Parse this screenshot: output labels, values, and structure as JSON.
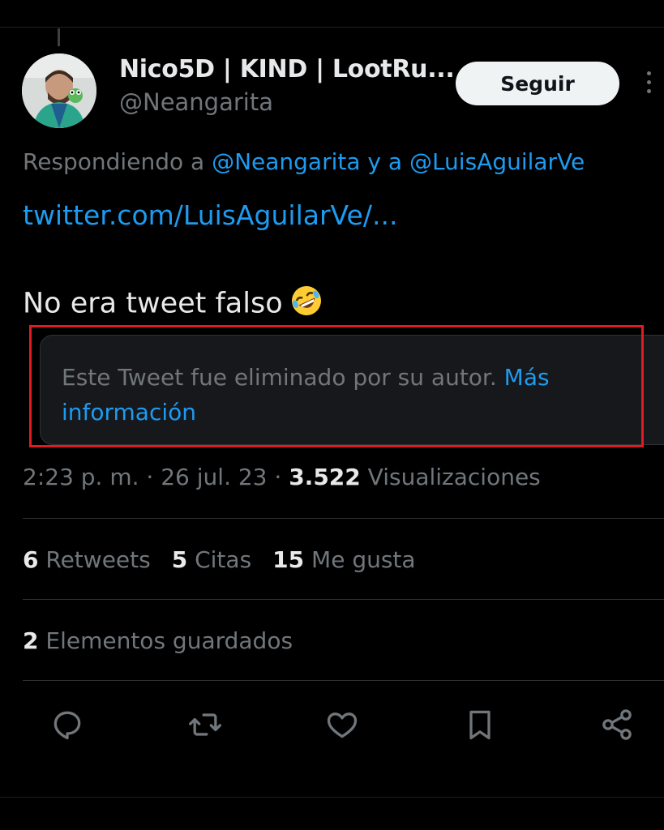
{
  "author": {
    "display_name": "Nico5D | KIND | LootRu...",
    "handle": "@Neangarita"
  },
  "follow_button": {
    "label": "Seguir"
  },
  "reply_context": {
    "prefix": "Respondiendo a ",
    "user1": "@Neangarita",
    "joiner": " y a ",
    "user2": "@LuisAguilarVe"
  },
  "tweet": {
    "link": "twitter.com/LuisAguilarVe/...",
    "text": "No era tweet falso",
    "emoji": "rolling-on-floor-laughing-emoji"
  },
  "deleted_notice": {
    "text": "Este Tweet fue eliminado por su autor. ",
    "link": "Más información"
  },
  "meta": {
    "time": "2:23 p. m.",
    "sep": " · ",
    "date": "26 jul. 23",
    "views_count": "3.522",
    "views_label": " Visualizaciones"
  },
  "stats": {
    "retweets_count": "6",
    "retweets_label": " Retweets",
    "quotes_count": "5",
    "quotes_label": " Citas",
    "likes_count": "15",
    "likes_label": " Me gusta"
  },
  "saved": {
    "count": "2",
    "label": " Elementos guardados"
  },
  "actions": [
    "reply-icon",
    "retweet-icon",
    "like-icon",
    "bookmark-icon",
    "share-icon"
  ],
  "colors": {
    "background": "#000000",
    "link": "#1d9bf0",
    "secondary_text": "#71767b",
    "primary_text": "#e7e9ea",
    "highlight_border": "#e01b24"
  }
}
